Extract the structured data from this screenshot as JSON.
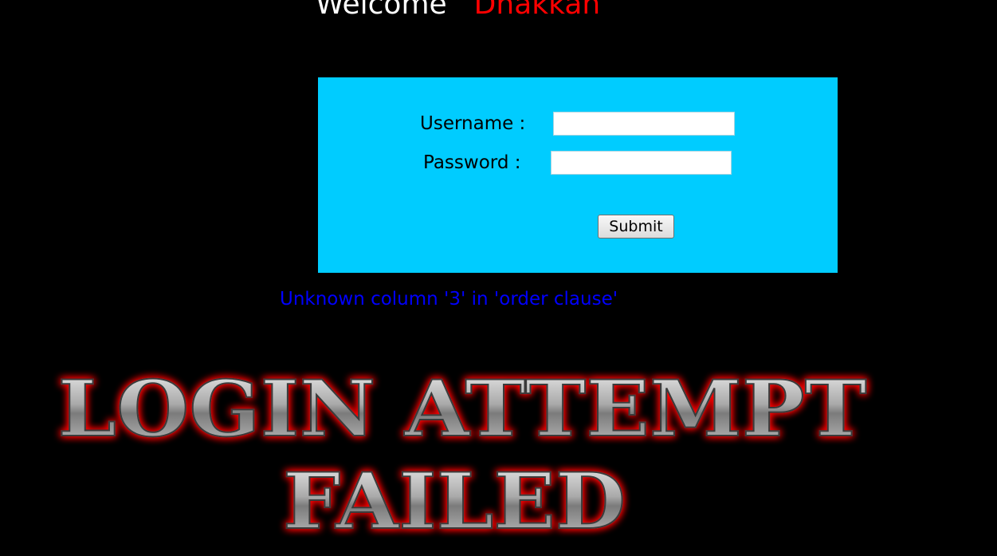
{
  "header": {
    "welcome_label": "Welcome",
    "user_name": "Dhakkan"
  },
  "login_form": {
    "username_label": "Username :",
    "password_label": "Password :",
    "username_value": "",
    "password_value": "",
    "submit_label": "Submit"
  },
  "error_message": "Unknown column '3' in 'order clause'",
  "banner": {
    "line1": "LOGIN ATTEMPT",
    "line2": "FAILED"
  },
  "colors": {
    "background": "#000000",
    "form_background": "#00ccff",
    "welcome_text": "#ffffff",
    "user_name_text": "#ff0000",
    "error_text": "#0000ff",
    "banner_glow": "#ff0000"
  }
}
